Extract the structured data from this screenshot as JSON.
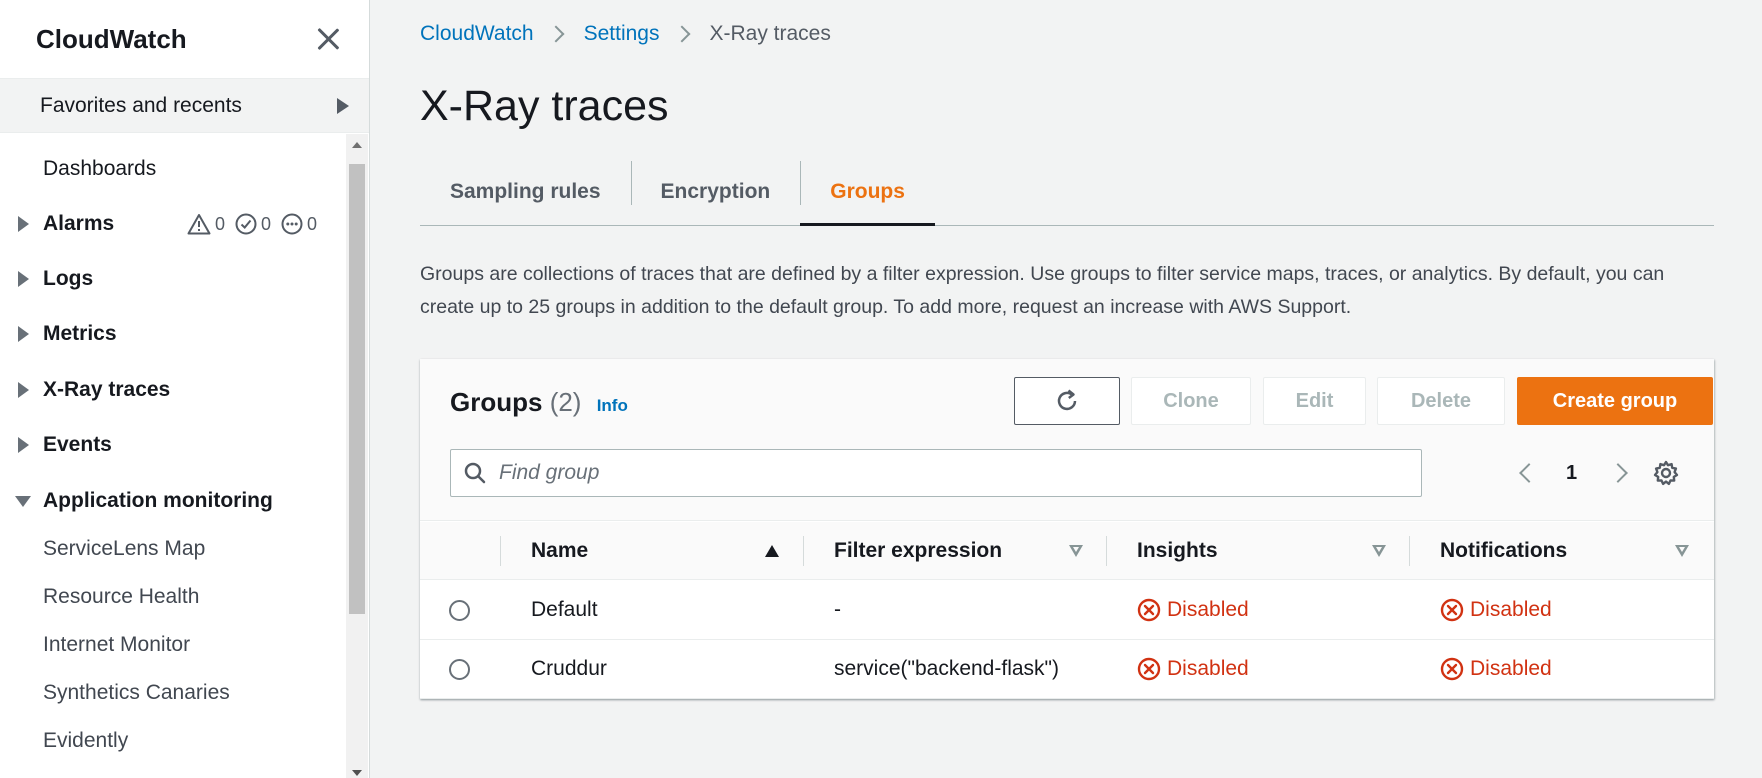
{
  "sidebar": {
    "title": "CloudWatch",
    "favorites_label": "Favorites and recents",
    "items": [
      {
        "label": "Dashboards"
      },
      {
        "label": "Alarms",
        "badges": {
          "alarm": "0",
          "ok": "0",
          "insufficient": "0"
        }
      },
      {
        "label": "Logs"
      },
      {
        "label": "Metrics"
      },
      {
        "label": "X-Ray traces"
      },
      {
        "label": "Events"
      },
      {
        "label": "Application monitoring"
      },
      {
        "label": "ServiceLens Map"
      },
      {
        "label": "Resource Health"
      },
      {
        "label": "Internet Monitor"
      },
      {
        "label": "Synthetics Canaries"
      },
      {
        "label": "Evidently"
      }
    ]
  },
  "breadcrumb": [
    "CloudWatch",
    "Settings",
    "X-Ray traces"
  ],
  "page_title": "X-Ray traces",
  "tabs": [
    {
      "label": "Sampling rules"
    },
    {
      "label": "Encryption"
    },
    {
      "label": "Groups"
    }
  ],
  "description": "Groups are collections of traces that are defined by a filter expression. Use groups to filter service maps, traces, or analytics. By default, you can create up to 25 groups in addition to the default group. To add more, request an increase with AWS Support.",
  "panel": {
    "title": "Groups",
    "count": "(2)",
    "info": "Info",
    "buttons": {
      "clone": "Clone",
      "edit": "Edit",
      "delete": "Delete",
      "create": "Create group"
    },
    "search_placeholder": "Find group",
    "page": "1",
    "columns": [
      "Name",
      "Filter expression",
      "Insights",
      "Notifications"
    ],
    "rows": [
      {
        "name": "Default",
        "filter": "-",
        "insights": "Disabled",
        "notifications": "Disabled"
      },
      {
        "name": "Cruddur",
        "filter": "service(\"backend-flask\")",
        "insights": "Disabled",
        "notifications": "Disabled"
      }
    ]
  },
  "colors": {
    "accent": "#ec7211",
    "link": "#0073bb",
    "error": "#d13212"
  }
}
